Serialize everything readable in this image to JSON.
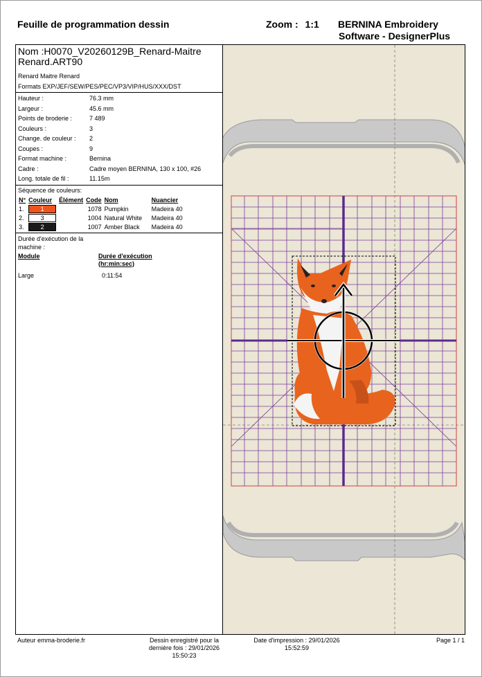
{
  "header": {
    "title": "Feuille de programmation dessin",
    "zoom_label": "Zoom :",
    "zoom_value": "1:1",
    "brand_line1": "BERNINA Embroidery",
    "brand_line2": "Software - DesignerPlus"
  },
  "design": {
    "name": "Nom :H0070_V20260129B_Renard-Maitre Renard.ART90",
    "description": "Renard Maitre Renard",
    "formats": "Formats EXP/JEF/SEW/PES/PEC/VP3/VIP/HUS/XXX/DST"
  },
  "properties": [
    {
      "label": "Hauteur :",
      "value": "76.3 mm"
    },
    {
      "label": "Largeur :",
      "value": "45.6 mm"
    },
    {
      "label": "Points de broderie :",
      "value": "7 489"
    },
    {
      "label": "Couleurs :",
      "value": "3"
    },
    {
      "label": "Change. de couleur :",
      "value": "2"
    },
    {
      "label": "Coupes :",
      "value": "9"
    },
    {
      "label": "Format machine :",
      "value": "Bernina"
    },
    {
      "label": "Cadre :",
      "value": "Cadre moyen BERNINA, 130 x 100, #26"
    },
    {
      "label": "Long. totale de fil :",
      "value": "11.15m"
    }
  ],
  "sequence": {
    "title": "Séquence de couleurs:",
    "headers": {
      "num": "N°",
      "color": "Couleur",
      "element": "Élément",
      "code": "Code",
      "name": "Nom",
      "chart": "Nuancier"
    },
    "rows": [
      {
        "num": "1.",
        "swatch": "1",
        "swatch_bg": "#f0531c",
        "swatch_fg": "#ffffff",
        "code": "1078",
        "name": "Pumpkin",
        "chart": "Madeira 40"
      },
      {
        "num": "2.",
        "swatch": "3",
        "swatch_bg": "#ffffff",
        "swatch_fg": "#000000",
        "code": "1004",
        "name": "Natural White",
        "chart": "Madeira 40"
      },
      {
        "num": "3.",
        "swatch": "2",
        "swatch_bg": "#1a1a1a",
        "swatch_fg": "#ffffff",
        "code": "1007",
        "name": "Amber Black",
        "chart": "Madeira 40"
      }
    ]
  },
  "duration": {
    "title": "Durée d'exécution de la machine :",
    "col_module": "Module",
    "col_duration_line1": "Durée d'exécution",
    "col_duration_line2": "(hr:min:sec)",
    "module": "Large",
    "value": "0:11:54"
  },
  "footer": {
    "author": "Auteur emma-broderie.fr",
    "saved_line1": "Dessin enregistré pour la",
    "saved_line2": "dernière fois : 29/01/2026",
    "saved_line3": "15:50:23",
    "printed_line1": "Date d'impression : 29/01/2026",
    "printed_line2": "15:52:59",
    "page": "Page 1 / 1"
  },
  "colors": {
    "canvas_bg": "#ebe6d6",
    "hoop": "#c9c9c9",
    "grid": "#7a3a9a",
    "grid_border": "#d04040",
    "axis": "#5a2a8a",
    "fox_orange": "#e8631e"
  },
  "icons": [
    "move-arrow-icon",
    "crosshair-icon"
  ]
}
